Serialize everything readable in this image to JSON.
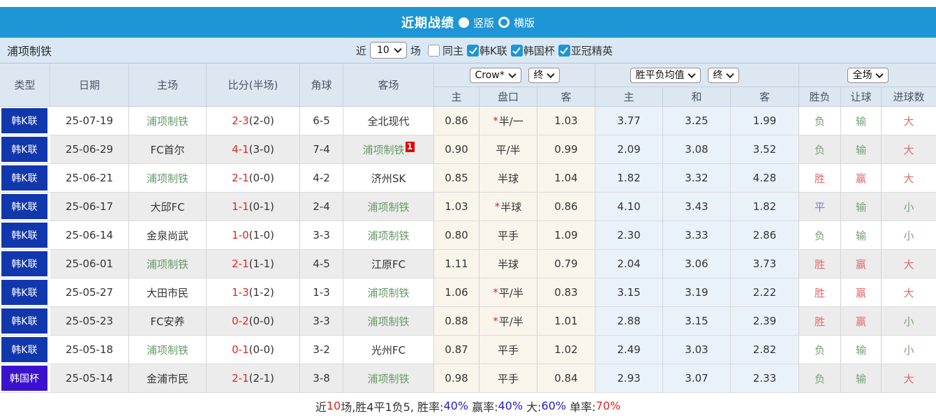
{
  "title_bar": {
    "title": "近期战绩",
    "radios": [
      {
        "label": "竖版",
        "selected": true
      },
      {
        "label": "横版",
        "selected": false
      }
    ]
  },
  "filter_bar": {
    "team": "浦项制铁",
    "near_label": "近",
    "count_value": "10",
    "games_label": "场",
    "checkboxes": [
      {
        "label": "同主",
        "checked": false
      },
      {
        "label": "韩K联",
        "checked": true
      },
      {
        "label": "韩国杯",
        "checked": true
      },
      {
        "label": "亚冠精英",
        "checked": true
      }
    ]
  },
  "table": {
    "main_headers": [
      "类型",
      "日期",
      "主场",
      "比分(半场)",
      "角球",
      "客场"
    ],
    "selects": {
      "crow": "Crow*",
      "crow_period": "终",
      "avg": "胜平负均值",
      "avg_period": "终",
      "scope": "全场"
    },
    "sub_headers": [
      "主",
      "盘口",
      "客",
      "主",
      "和",
      "客",
      "胜负",
      "让球",
      "进球数"
    ],
    "rows": [
      {
        "type": "韩K联",
        "type_kind": "league",
        "date": "25-07-19",
        "home": "浦项制铁",
        "home_self": true,
        "score": "2-3",
        "half": "(2-0)",
        "corners": "6-5",
        "away": "全北现代",
        "away_self": false,
        "away_badge": "",
        "crow_home": "0.86",
        "handicap": "半/一",
        "handicap_star": true,
        "crow_away": "1.03",
        "avg_home": "3.77",
        "avg_draw": "3.25",
        "avg_away": "1.99",
        "result_wdl": "负",
        "result_handicap": "输",
        "result_goals": "大"
      },
      {
        "type": "韩K联",
        "type_kind": "league",
        "date": "25-06-29",
        "home": "FC首尔",
        "home_self": false,
        "score": "4-1",
        "half": "(3-0)",
        "corners": "7-4",
        "away": "浦项制铁",
        "away_self": true,
        "away_badge": "1",
        "crow_home": "0.90",
        "handicap": "平/半",
        "handicap_star": false,
        "crow_away": "0.99",
        "avg_home": "2.09",
        "avg_draw": "3.08",
        "avg_away": "3.52",
        "result_wdl": "负",
        "result_handicap": "输",
        "result_goals": "大"
      },
      {
        "type": "韩K联",
        "type_kind": "league",
        "date": "25-06-21",
        "home": "浦项制铁",
        "home_self": true,
        "score": "2-1",
        "half": "(0-0)",
        "corners": "4-2",
        "away": "济州SK",
        "away_self": false,
        "away_badge": "",
        "crow_home": "0.85",
        "handicap": "半球",
        "handicap_star": false,
        "crow_away": "1.04",
        "avg_home": "1.82",
        "avg_draw": "3.32",
        "avg_away": "4.28",
        "result_wdl": "胜",
        "result_handicap": "赢",
        "result_goals": "大"
      },
      {
        "type": "韩K联",
        "type_kind": "league",
        "date": "25-06-17",
        "home": "大邱FC",
        "home_self": false,
        "score": "1-1",
        "half": "(0-1)",
        "corners": "2-4",
        "away": "浦项制铁",
        "away_self": true,
        "away_badge": "",
        "crow_home": "1.03",
        "handicap": "半球",
        "handicap_star": true,
        "crow_away": "0.86",
        "avg_home": "4.10",
        "avg_draw": "3.43",
        "avg_away": "1.82",
        "result_wdl": "平",
        "result_handicap": "输",
        "result_goals": "小"
      },
      {
        "type": "韩K联",
        "type_kind": "league",
        "date": "25-06-14",
        "home": "金泉尚武",
        "home_self": false,
        "score": "1-0",
        "half": "(1-0)",
        "corners": "3-3",
        "away": "浦项制铁",
        "away_self": true,
        "away_badge": "",
        "crow_home": "0.80",
        "handicap": "平手",
        "handicap_star": false,
        "crow_away": "1.09",
        "avg_home": "2.30",
        "avg_draw": "3.33",
        "avg_away": "2.86",
        "result_wdl": "负",
        "result_handicap": "输",
        "result_goals": "小"
      },
      {
        "type": "韩K联",
        "type_kind": "league",
        "date": "25-06-01",
        "home": "浦项制铁",
        "home_self": true,
        "score": "2-1",
        "half": "(1-1)",
        "corners": "4-5",
        "away": "江原FC",
        "away_self": false,
        "away_badge": "",
        "crow_home": "1.11",
        "handicap": "半球",
        "handicap_star": false,
        "crow_away": "0.79",
        "avg_home": "2.04",
        "avg_draw": "3.06",
        "avg_away": "3.73",
        "result_wdl": "胜",
        "result_handicap": "赢",
        "result_goals": "大"
      },
      {
        "type": "韩K联",
        "type_kind": "league",
        "date": "25-05-27",
        "home": "大田市民",
        "home_self": false,
        "score": "1-3",
        "half": "(1-2)",
        "corners": "1-3",
        "away": "浦项制铁",
        "away_self": true,
        "away_badge": "",
        "crow_home": "1.06",
        "handicap": "平/半",
        "handicap_star": true,
        "crow_away": "0.83",
        "avg_home": "3.15",
        "avg_draw": "3.19",
        "avg_away": "2.22",
        "result_wdl": "胜",
        "result_handicap": "赢",
        "result_goals": "大"
      },
      {
        "type": "韩K联",
        "type_kind": "league",
        "date": "25-05-23",
        "home": "FC安养",
        "home_self": false,
        "score": "0-2",
        "half": "(0-0)",
        "corners": "3-3",
        "away": "浦项制铁",
        "away_self": true,
        "away_badge": "",
        "crow_home": "0.88",
        "handicap": "平/半",
        "handicap_star": true,
        "crow_away": "1.01",
        "avg_home": "2.88",
        "avg_draw": "3.15",
        "avg_away": "2.39",
        "result_wdl": "胜",
        "result_handicap": "赢",
        "result_goals": "小"
      },
      {
        "type": "韩K联",
        "type_kind": "league",
        "date": "25-05-18",
        "home": "浦项制铁",
        "home_self": true,
        "score": "0-1",
        "half": "(0-0)",
        "corners": "3-2",
        "away": "光州FC",
        "away_self": false,
        "away_badge": "",
        "crow_home": "0.87",
        "handicap": "平手",
        "handicap_star": false,
        "crow_away": "1.02",
        "avg_home": "2.49",
        "avg_draw": "3.03",
        "avg_away": "2.82",
        "result_wdl": "负",
        "result_handicap": "输",
        "result_goals": "小"
      },
      {
        "type": "韩国杯",
        "type_kind": "cup",
        "date": "25-05-14",
        "home": "金浦市民",
        "home_self": false,
        "score": "2-1",
        "half": "(2-1)",
        "corners": "3-8",
        "away": "浦项制铁",
        "away_self": true,
        "away_badge": "",
        "crow_home": "0.98",
        "handicap": "平手",
        "handicap_star": false,
        "crow_away": "0.84",
        "avg_home": "2.93",
        "avg_draw": "3.07",
        "avg_away": "2.33",
        "result_wdl": "负",
        "result_handicap": "输",
        "result_goals": "大"
      }
    ]
  },
  "footer": {
    "segments": [
      {
        "text": "近",
        "color": "dark"
      },
      {
        "text": "10",
        "color": "red"
      },
      {
        "text": "场,胜4平1负5, ",
        "color": "dark"
      },
      {
        "text": "胜率:",
        "color": "dark"
      },
      {
        "text": "40%",
        "color": "blue"
      },
      {
        "text": " 赢率:",
        "color": "dark"
      },
      {
        "text": "40%",
        "color": "blue"
      },
      {
        "text": " 大:",
        "color": "dark"
      },
      {
        "text": "60%",
        "color": "blue"
      },
      {
        "text": " 单率:",
        "color": "dark"
      },
      {
        "text": "70%",
        "color": "red"
      }
    ]
  },
  "colors": {
    "accent": "#1e96d5",
    "league_badge": "#1137ad",
    "cup_badge": "#3a11cf",
    "self_green": "#689a68",
    "score_red": "#e8221d",
    "win_red": "#e06a6a",
    "lose_green": "#74a274",
    "draw_blue": "#7474dd",
    "footer_blue": "#1d1dd1"
  }
}
